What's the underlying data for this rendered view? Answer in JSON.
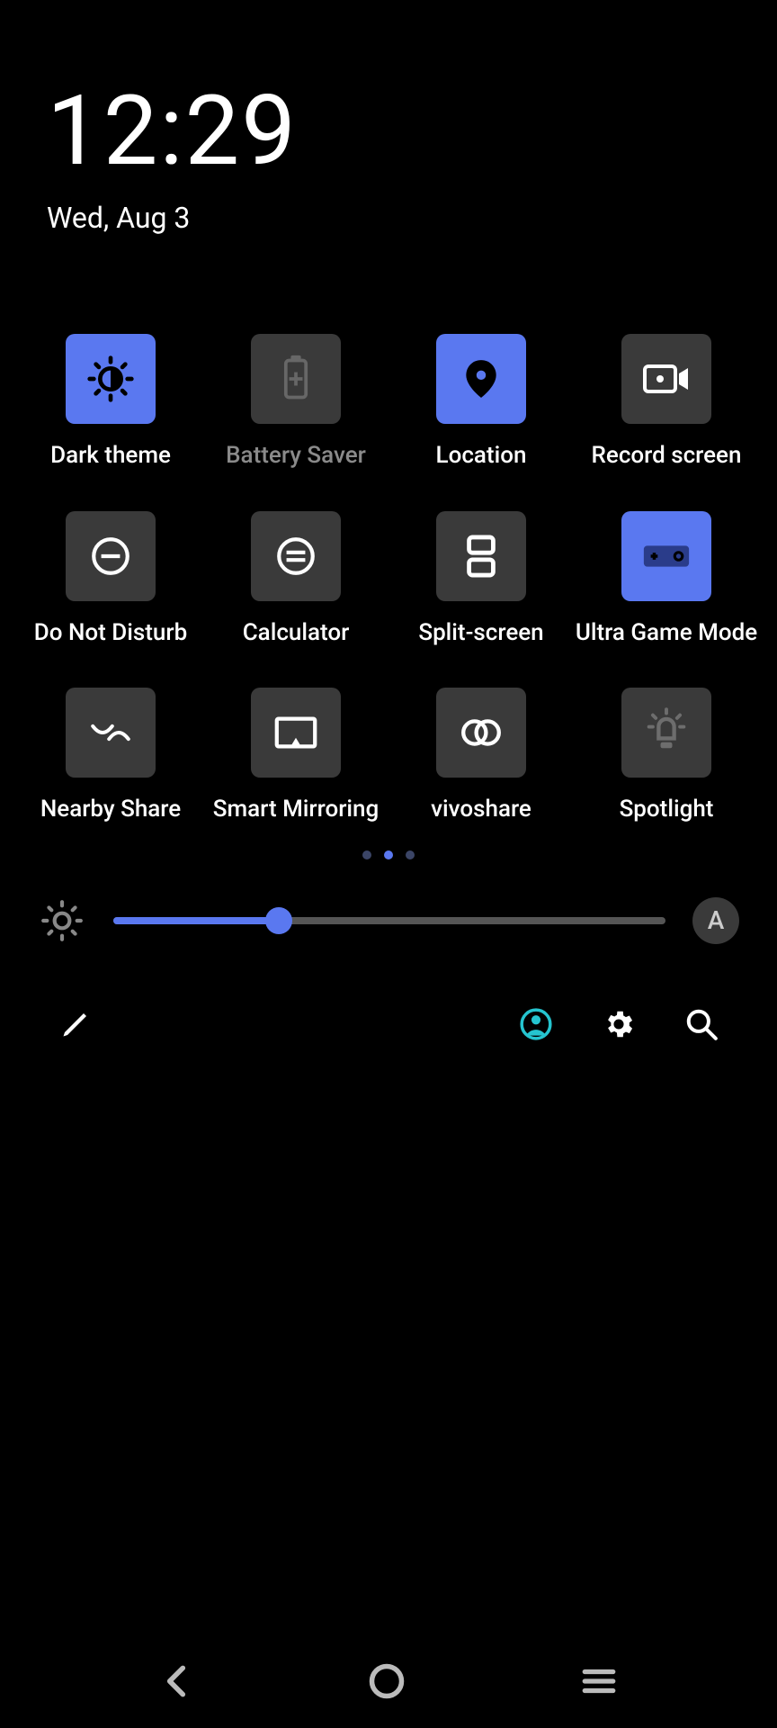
{
  "header": {
    "time": "12:29",
    "date": "Wed, Aug 3"
  },
  "tiles": [
    {
      "id": "dark-theme",
      "label": "Dark theme",
      "active": true,
      "dimmed": false
    },
    {
      "id": "battery-saver",
      "label": "Battery Saver",
      "active": false,
      "dimmed": true
    },
    {
      "id": "location",
      "label": "Location",
      "active": true,
      "dimmed": false
    },
    {
      "id": "record-screen",
      "label": "Record screen",
      "active": false,
      "dimmed": false
    },
    {
      "id": "dnd",
      "label": "Do Not Disturb",
      "active": false,
      "dimmed": false
    },
    {
      "id": "calculator",
      "label": "Calculator",
      "active": false,
      "dimmed": false
    },
    {
      "id": "split-screen",
      "label": "Split-screen",
      "active": false,
      "dimmed": false
    },
    {
      "id": "ultra-game",
      "label": "Ultra Game Mode",
      "active": true,
      "dimmed": false
    },
    {
      "id": "nearby-share",
      "label": "Nearby Share",
      "active": false,
      "dimmed": false
    },
    {
      "id": "smart-mirror",
      "label": "Smart Mirroring",
      "active": false,
      "dimmed": false
    },
    {
      "id": "vivoshare",
      "label": "vivoshare",
      "active": false,
      "dimmed": false
    },
    {
      "id": "spotlight",
      "label": "Spotlight",
      "active": false,
      "dimmed": true
    }
  ],
  "pager": {
    "total": 3,
    "active_index": 1
  },
  "brightness": {
    "percent": 30,
    "auto_label": "A"
  },
  "colors": {
    "accent": "#5a78f0",
    "tile_bg": "#3a3a3a",
    "profile_accent": "#25c4cf"
  }
}
